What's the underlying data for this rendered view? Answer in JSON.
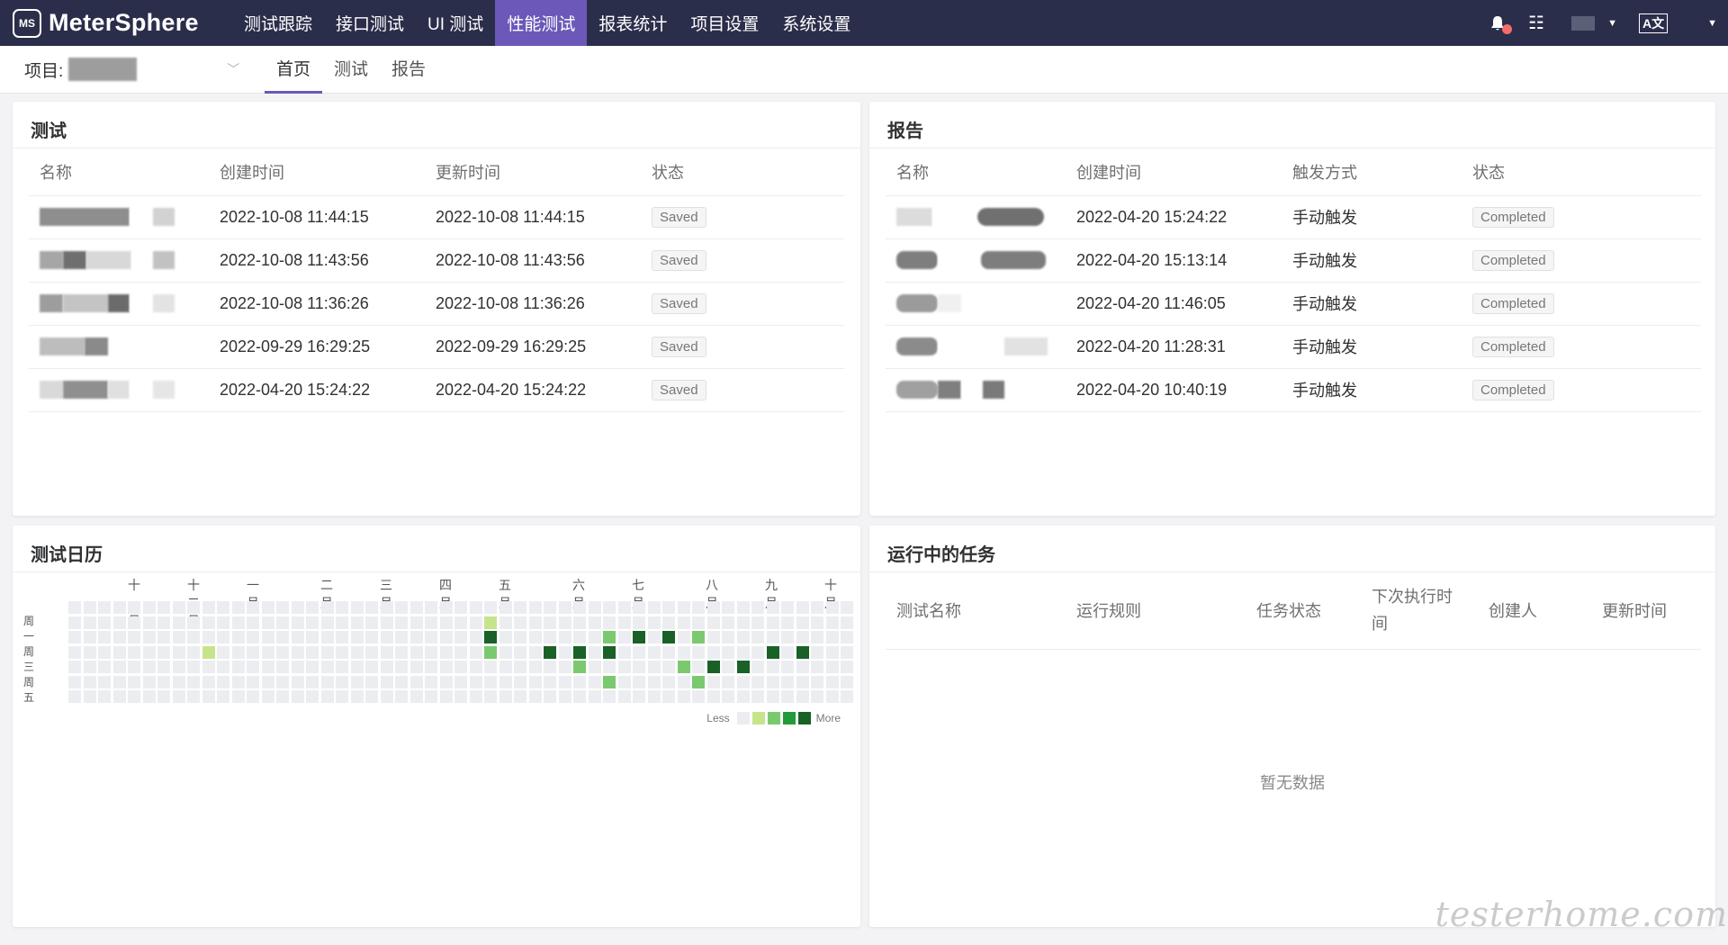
{
  "brand": {
    "name": "MeterSphere",
    "logo_text": "MS"
  },
  "nav": {
    "items": [
      "测试跟踪",
      "接口测试",
      "UI 测试",
      "性能测试",
      "报表统计",
      "项目设置",
      "系统设置"
    ],
    "active_index": 3
  },
  "top_right": {
    "lang_label": "A文"
  },
  "project": {
    "label": "项目:"
  },
  "subtabs": {
    "items": [
      "首页",
      "测试",
      "报告"
    ],
    "active_index": 0
  },
  "test_card": {
    "title": "测试",
    "columns": [
      "名称",
      "创建时间",
      "更新时间",
      "状态"
    ],
    "rows": [
      {
        "created": "2022-10-08 11:44:15",
        "updated": "2022-10-08 11:44:15",
        "status": "Saved"
      },
      {
        "created": "2022-10-08 11:43:56",
        "updated": "2022-10-08 11:43:56",
        "status": "Saved"
      },
      {
        "created": "2022-10-08 11:36:26",
        "updated": "2022-10-08 11:36:26",
        "status": "Saved"
      },
      {
        "created": "2022-09-29 16:29:25",
        "updated": "2022-09-29 16:29:25",
        "status": "Saved"
      },
      {
        "created": "2022-04-20 15:24:22",
        "updated": "2022-04-20 15:24:22",
        "status": "Saved"
      }
    ]
  },
  "report_card": {
    "title": "报告",
    "columns": [
      "名称",
      "创建时间",
      "触发方式",
      "状态"
    ],
    "rows": [
      {
        "created": "2022-04-20 15:24:22",
        "trigger": "手动触发",
        "status": "Completed"
      },
      {
        "created": "2022-04-20 15:13:14",
        "trigger": "手动触发",
        "status": "Completed"
      },
      {
        "created": "2022-04-20 11:46:05",
        "trigger": "手动触发",
        "status": "Completed"
      },
      {
        "created": "2022-04-20 11:28:31",
        "trigger": "手动触发",
        "status": "Completed"
      },
      {
        "created": "2022-04-20 10:40:19",
        "trigger": "手动触发",
        "status": "Completed"
      }
    ]
  },
  "calendar_card": {
    "title": "测试日历",
    "months": [
      "十一月",
      "十二月",
      "一月",
      "二月",
      "三月",
      "四月",
      "五月",
      "六月",
      "七月",
      "八月",
      "九月",
      "十月"
    ],
    "days": [
      "周一",
      "周三",
      "周五"
    ],
    "legend_less": "Less",
    "legend_more": "More",
    "colors": [
      "#ebedf0",
      "#c6e48b",
      "#7bc96f",
      "#239a3b",
      "#196127"
    ]
  },
  "running_card": {
    "title": "运行中的任务",
    "columns": [
      "测试名称",
      "运行规则",
      "任务状态",
      "下次执行时间",
      "创建人",
      "更新时间"
    ],
    "empty_text": "暂无数据"
  },
  "watermark": "testerhome.com"
}
